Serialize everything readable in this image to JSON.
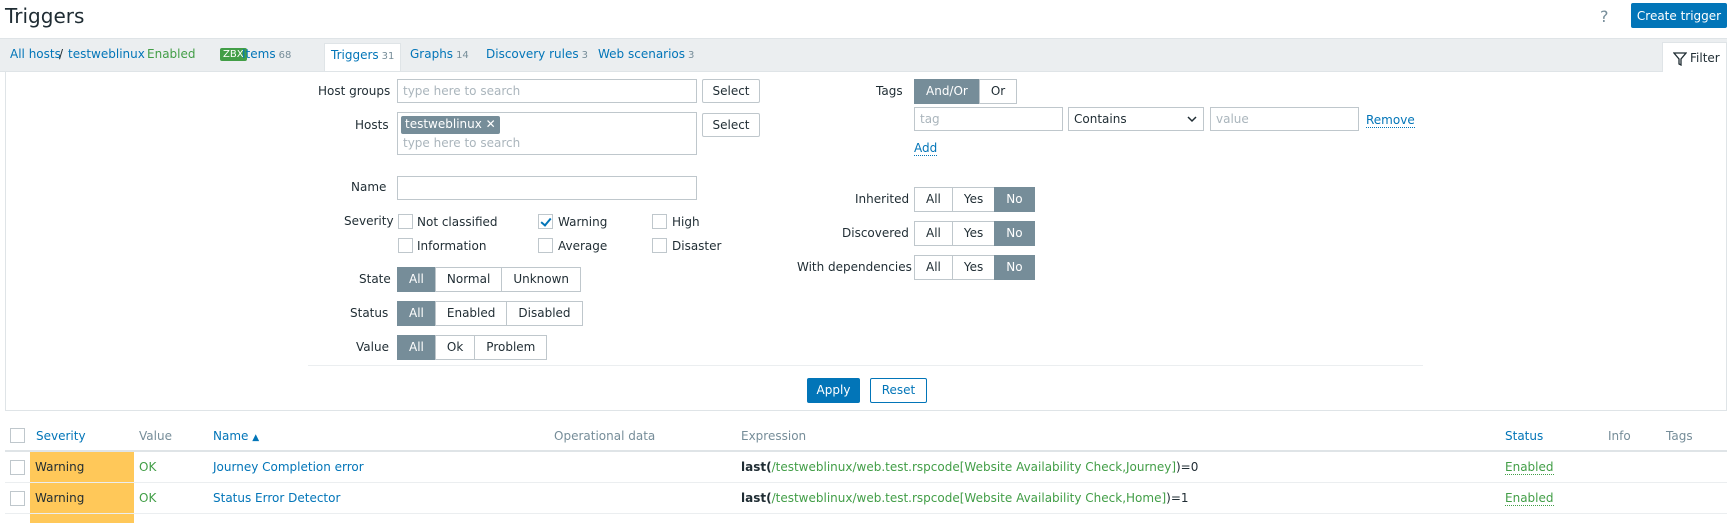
{
  "header": {
    "title": "Triggers",
    "help": "?",
    "create_label": "Create trigger"
  },
  "hostnav": {
    "all_hosts": "All hosts",
    "separator": "/",
    "host": "testweblinux",
    "enabled": "Enabled",
    "zbx": "ZBX",
    "items_label": "Items",
    "items_count": "68",
    "triggers_label": "Triggers",
    "triggers_count": "31",
    "graphs_label": "Graphs",
    "graphs_count": "14",
    "discovery_label": "Discovery rules",
    "discovery_count": "3",
    "web_label": "Web scenarios",
    "web_count": "3",
    "filter_label": "Filter"
  },
  "filter": {
    "host_groups_label": "Host groups",
    "host_groups_placeholder": "type here to search",
    "select_label": "Select",
    "hosts_label": "Hosts",
    "hosts_chip": "testweblinux",
    "hosts_placeholder": "type here to search",
    "name_label": "Name",
    "name_value": "",
    "severity_label": "Severity",
    "severities": {
      "not_classified": "Not classified",
      "warning": "Warning",
      "high": "High",
      "information": "Information",
      "average": "Average",
      "disaster": "Disaster"
    },
    "state_label": "State",
    "state_options": [
      "All",
      "Normal",
      "Unknown"
    ],
    "status_label": "Status",
    "status_options": [
      "All",
      "Enabled",
      "Disabled"
    ],
    "value_label": "Value",
    "value_options": [
      "All",
      "Ok",
      "Problem"
    ],
    "tags_label": "Tags",
    "tags_options": [
      "And/Or",
      "Or"
    ],
    "tag_placeholder": "tag",
    "operator_value": "Contains",
    "value_placeholder": "value",
    "remove_label": "Remove",
    "add_label": "Add",
    "inherited_label": "Inherited",
    "discovered_label": "Discovered",
    "with_dependencies_label": "With dependencies",
    "ayn_options": [
      "All",
      "Yes",
      "No"
    ],
    "apply_label": "Apply",
    "reset_label": "Reset"
  },
  "table": {
    "headers": {
      "severity": "Severity",
      "value": "Value",
      "name": "Name",
      "sort_arrow": "▲",
      "operational_data": "Operational data",
      "expression": "Expression",
      "status": "Status",
      "info": "Info",
      "tags": "Tags"
    },
    "rows": [
      {
        "severity": "Warning",
        "value": "OK",
        "name": "Journey Completion error",
        "expr_fn": "last",
        "expr_open": "(",
        "expr_item": "/testweblinux/web.test.rspcode[Website Availability Check,Journey]",
        "expr_close": ")=0",
        "status": "Enabled"
      },
      {
        "severity": "Warning",
        "value": "OK",
        "name": "Status Error Detector",
        "expr_fn": "last",
        "expr_open": "(",
        "expr_item": "/testweblinux/web.test.rspcode[Website Availability Check,Home]",
        "expr_close": ")=1",
        "status": "Enabled"
      }
    ]
  }
}
